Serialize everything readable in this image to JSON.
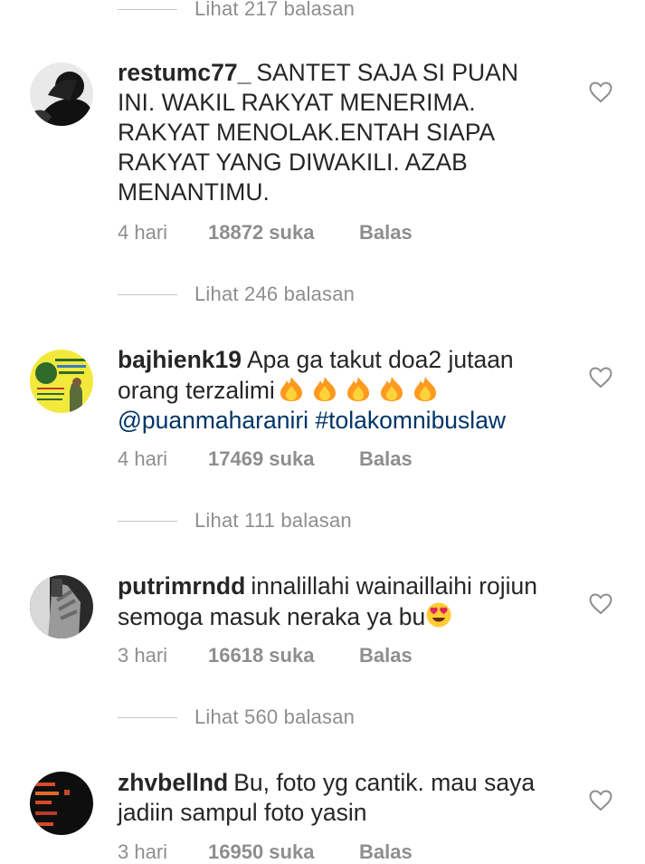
{
  "thread": [
    {
      "replies": "Lihat 217 balasan"
    },
    {
      "username": "restumc77_",
      "text": "SANTET SAJA SI PUAN INI. WAKIL RAKYAT MENERIMA. RAKYAT MENOLAK.ENTAH SIAPA RAKYAT YANG DIWAKILI. AZAB MENANTIMU.",
      "time": "4 hari",
      "likes": "18872 suka",
      "reply_label": "Balas"
    },
    {
      "replies": "Lihat 246 balasan"
    },
    {
      "username": "bajhienk19",
      "text": "Apa ga takut doa2 jutaan orang terzalimi",
      "emoji": [
        "fire-emoji",
        "fire-emoji",
        "fire-emoji",
        "fire-emoji",
        "fire-emoji"
      ],
      "mention": "@puanmaharaniri",
      "hashtag": "#tolakomnibuslaw",
      "time": "4 hari",
      "likes": "17469 suka",
      "reply_label": "Balas"
    },
    {
      "replies": "Lihat 111 balasan"
    },
    {
      "username": "putrimrndd",
      "text": "innalillahi wainaillaihi rojiun semoga masuk neraka ya bu",
      "emoji": [
        "heart-eyes-emoji"
      ],
      "time": "3 hari",
      "likes": "16618 suka",
      "reply_label": "Balas"
    },
    {
      "replies": "Lihat 560 balasan"
    },
    {
      "username": "zhvbellnd",
      "text": "Bu, foto yg cantik. mau saya jadiin sampul foto yasin",
      "time": "3 hari",
      "likes": "16950 suka",
      "reply_label": "Balas"
    }
  ],
  "colors": {
    "text": "#262626",
    "muted": "#8e8e8e",
    "link": "#003569",
    "divider": "#c7c7c7"
  }
}
